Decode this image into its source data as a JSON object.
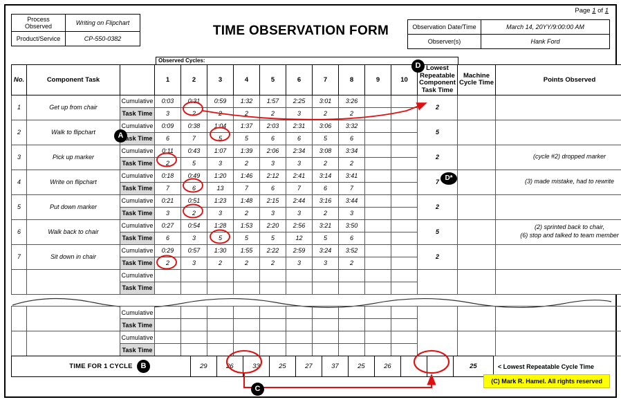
{
  "page_label": {
    "prefix": "Page",
    "number": "1",
    "mid": "of",
    "total": "1"
  },
  "title": "TIME OBSERVATION FORM",
  "header_left": {
    "rows": [
      {
        "label": "Process Observed",
        "value": "Writing on Flipchart"
      },
      {
        "label": "Product/Service",
        "value": "CP-550-0382"
      }
    ]
  },
  "header_right": {
    "rows": [
      {
        "label": "Observation Date/Time",
        "value": "March 14, 20YY/9:00:00 AM"
      },
      {
        "label": "Observer(s)",
        "value": "Hank Ford"
      }
    ]
  },
  "observed_cycles_caption": "Observed Cycles:",
  "columns": {
    "no": "No.",
    "task": "Component Task",
    "cycles": [
      "1",
      "2",
      "3",
      "4",
      "5",
      "6",
      "7",
      "8",
      "9",
      "10"
    ],
    "lowest": "Lowest Repeatable Component Task Time",
    "machine": "Machine Cycle Time",
    "points": "Points Observed"
  },
  "row_type_labels": {
    "cumulative": "Cumulative",
    "task_time": "Task Time"
  },
  "tasks": [
    {
      "no": "1",
      "name": "Get up from chair",
      "cumulative": [
        "0:03",
        "0:31",
        "0:59",
        "1:32",
        "1:57",
        "2:25",
        "3:01",
        "3:26",
        "",
        ""
      ],
      "task_time": [
        "3",
        "2",
        "2",
        "2",
        "2",
        "3",
        "2",
        "2",
        "",
        ""
      ],
      "lowest": "2",
      "machine": "",
      "points": "",
      "circled_cycle": 2
    },
    {
      "no": "2",
      "name": "Walk to flipchart",
      "cumulative": [
        "0:09",
        "0:38",
        "1:04",
        "1:37",
        "2:03",
        "2:31",
        "3:06",
        "3:32",
        "",
        ""
      ],
      "task_time": [
        "6",
        "7",
        "5",
        "5",
        "6",
        "6",
        "5",
        "6",
        "",
        ""
      ],
      "lowest": "5",
      "machine": "",
      "points": "",
      "circled_cycle": 3
    },
    {
      "no": "3",
      "name": "Pick up marker",
      "cumulative": [
        "0:11",
        "0:43",
        "1:07",
        "1:39",
        "2:06",
        "2:34",
        "3:08",
        "3:34",
        "",
        ""
      ],
      "task_time": [
        "2",
        "5",
        "3",
        "2",
        "3",
        "3",
        "2",
        "2",
        "",
        ""
      ],
      "lowest": "2",
      "machine": "",
      "points": "(cycle #2) dropped marker",
      "circled_cycle": 1
    },
    {
      "no": "4",
      "name": "Write on flipchart",
      "cumulative": [
        "0:18",
        "0:49",
        "1:20",
        "1:46",
        "2:12",
        "2:41",
        "3:14",
        "3:41",
        "",
        ""
      ],
      "task_time": [
        "7",
        "6",
        "13",
        "7",
        "6",
        "7",
        "6",
        "7",
        "",
        ""
      ],
      "lowest": "7",
      "machine": "",
      "points": "(3) made mistake, had to rewrite",
      "circled_cycle": 2
    },
    {
      "no": "5",
      "name": "Put down marker",
      "cumulative": [
        "0:21",
        "0:51",
        "1:23",
        "1:48",
        "2:15",
        "2:44",
        "3:16",
        "3:44",
        "",
        ""
      ],
      "task_time": [
        "3",
        "2",
        "3",
        "2",
        "3",
        "3",
        "2",
        "3",
        "",
        ""
      ],
      "lowest": "2",
      "machine": "",
      "points": "",
      "circled_cycle": 2
    },
    {
      "no": "6",
      "name": "Walk back to chair",
      "cumulative": [
        "0:27",
        "0:54",
        "1:28",
        "1:53",
        "2:20",
        "2:56",
        "3:21",
        "3:50",
        "",
        ""
      ],
      "task_time": [
        "6",
        "3",
        "5",
        "5",
        "5",
        "12",
        "5",
        "6",
        "",
        ""
      ],
      "lowest": "5",
      "machine": "",
      "points": "(2) sprinted back to chair,\n(6) stop and talked to team member",
      "circled_cycle": 3
    },
    {
      "no": "7",
      "name": "Sit down in chair",
      "cumulative": [
        "0:29",
        "0:57",
        "1:30",
        "1:55",
        "2:22",
        "2:59",
        "3:24",
        "3:52",
        "",
        ""
      ],
      "task_time": [
        "2",
        "3",
        "2",
        "2",
        "2",
        "3",
        "3",
        "2",
        "",
        ""
      ],
      "lowest": "2",
      "machine": "",
      "points": "",
      "circled_cycle": 1
    },
    {
      "no": "",
      "name": "",
      "cumulative": [
        "",
        "",
        "",
        "",
        "",
        "",
        "",
        "",
        "",
        ""
      ],
      "task_time": [
        "",
        "",
        "",
        "",
        "",
        "",
        "",
        "",
        "",
        ""
      ],
      "lowest": "",
      "machine": "",
      "points": "",
      "circled_cycle": 0
    }
  ],
  "continued_tasks": [
    {
      "no": "",
      "name": "",
      "cumulative": [
        "",
        "",
        "",
        "",
        "",
        "",
        "",
        "",
        "",
        ""
      ],
      "task_time": [
        "",
        "",
        "",
        "",
        "",
        "",
        "",
        "",
        "",
        ""
      ],
      "lowest": "",
      "machine": "",
      "points": ""
    },
    {
      "no": "",
      "name": "",
      "cumulative": [
        "",
        "",
        "",
        "",
        "",
        "",
        "",
        "",
        "",
        ""
      ],
      "task_time": [
        "",
        "",
        "",
        "",
        "",
        "",
        "",
        "",
        "",
        ""
      ],
      "lowest": "",
      "machine": "",
      "points": ""
    }
  ],
  "totals": {
    "label": "TIME FOR 1 CYCLE",
    "values": [
      "29",
      "26",
      "33",
      "25",
      "27",
      "37",
      "25",
      "26",
      "",
      ""
    ],
    "lowest_repeatable_cycle_time": "25",
    "note": "< Lowest Repeatable Cycle Time",
    "circled_cycle_index": 4
  },
  "callouts": [
    {
      "id": "A",
      "label": "A"
    },
    {
      "id": "B",
      "label": "B"
    },
    {
      "id": "C",
      "label": "C"
    },
    {
      "id": "D",
      "label": "D"
    },
    {
      "id": "Dstar",
      "label": "D*"
    }
  ],
  "copyright": "(C) Mark R. Hamel. All rights reserved",
  "colors": {
    "cumulative_red": "#e01010",
    "annotation_red": "#e11010",
    "type_cell_gray": "#d9d9d9",
    "copyright_yellow": "#ffff00"
  }
}
